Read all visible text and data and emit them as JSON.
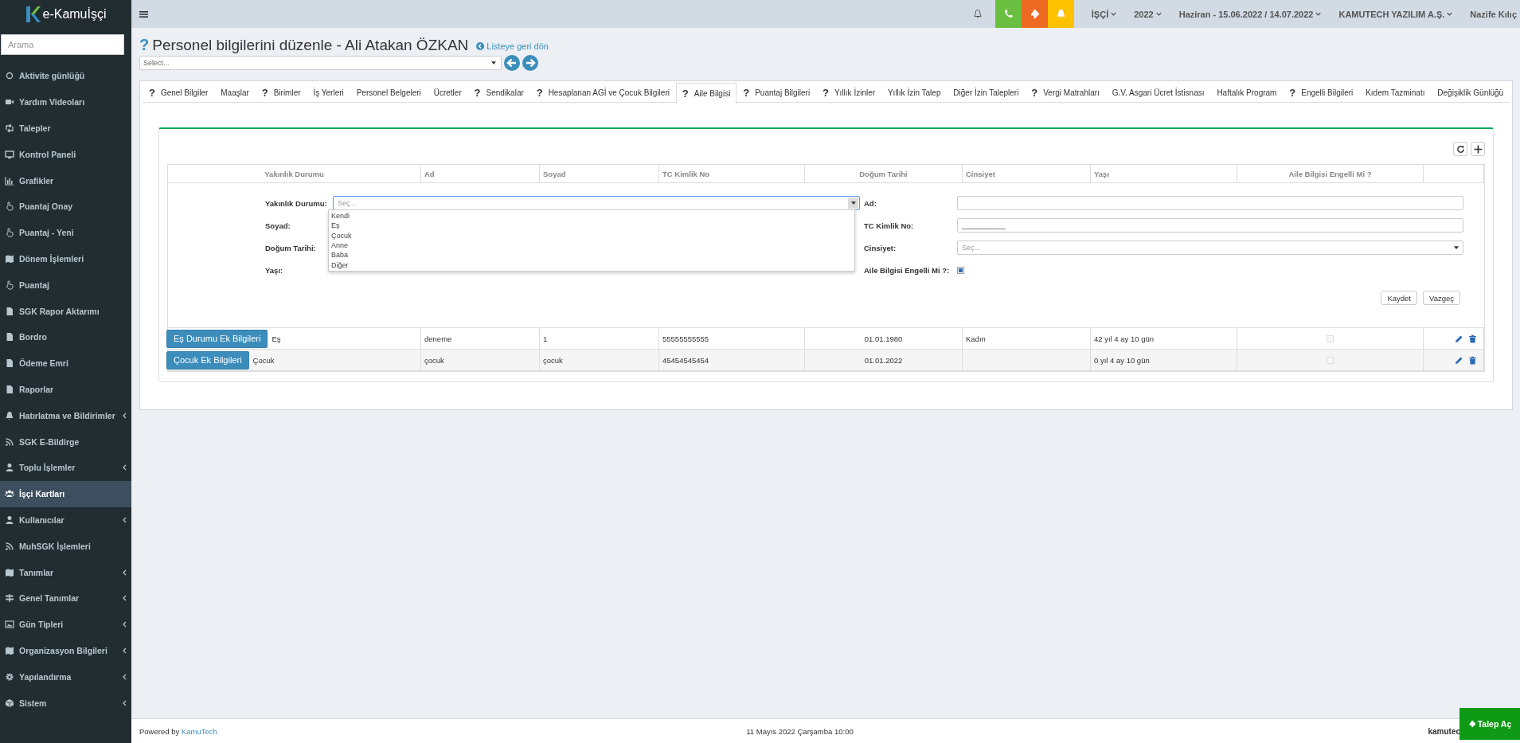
{
  "sidebar": {
    "logo": "e-Kamuİşçi",
    "search": {
      "placeholder": "Arama"
    },
    "items": [
      {
        "label": "Aktivite günlüğü",
        "expandable": false,
        "selected": false
      },
      {
        "label": "Yardım Videoları",
        "expandable": false,
        "selected": false
      },
      {
        "label": "Talepler",
        "expandable": false,
        "selected": false
      },
      {
        "label": "Kontrol Paneli",
        "expandable": false,
        "selected": false
      },
      {
        "label": "Grafikler",
        "expandable": false,
        "selected": false
      },
      {
        "label": "Puantaj Onay",
        "expandable": false,
        "selected": false
      },
      {
        "label": "Puantaj - Yeni",
        "expandable": false,
        "selected": false
      },
      {
        "label": "Dönem İşlemleri",
        "expandable": false,
        "selected": false
      },
      {
        "label": "Puantaj",
        "expandable": false,
        "selected": false
      },
      {
        "label": "SGK Rapor Aktarımı",
        "expandable": false,
        "selected": false
      },
      {
        "label": "Bordro",
        "expandable": false,
        "selected": false
      },
      {
        "label": "Ödeme Emri",
        "expandable": false,
        "selected": false
      },
      {
        "label": "Raporlar",
        "expandable": false,
        "selected": false
      },
      {
        "label": "Hatırlatma ve Bildirimler",
        "expandable": true,
        "selected": false
      },
      {
        "label": "SGK E-Bildirge",
        "expandable": false,
        "selected": false
      },
      {
        "label": "Toplu İşlemler",
        "expandable": true,
        "selected": false
      },
      {
        "label": "İşçi Kartları",
        "expandable": false,
        "selected": true
      },
      {
        "label": "Kullanıcılar",
        "expandable": true,
        "selected": false
      },
      {
        "label": "MuhSGK İşlemleri",
        "expandable": false,
        "selected": false
      },
      {
        "label": "Tanımlar",
        "expandable": true,
        "selected": false
      },
      {
        "label": "Genel Tanımlar",
        "expandable": true,
        "selected": false
      },
      {
        "label": "Gün Tipleri",
        "expandable": true,
        "selected": false
      },
      {
        "label": "Organizasyon Bilgileri",
        "expandable": true,
        "selected": false
      },
      {
        "label": "Yapılandırma",
        "expandable": true,
        "selected": false
      },
      {
        "label": "Sistem",
        "expandable": true,
        "selected": false
      }
    ]
  },
  "topbar": {
    "buttons": [
      {
        "color": "#6abf40"
      },
      {
        "color": "#ee6a23"
      },
      {
        "color": "#ffc200"
      }
    ],
    "menus": [
      "İŞÇİ",
      "2022",
      "Haziran - 15.06.2022 / 14.07.2022",
      "KAMUTECH YAZILIM A.Ş."
    ],
    "user": "Nazife Kılıç"
  },
  "page": {
    "title_mark": "?",
    "title": "Personel bilgilerini düzenle - Ali Atakan ÖZKAN",
    "back_link": "Listeye geri dön",
    "select": {
      "placeholder": "Select..."
    }
  },
  "tabs": [
    {
      "mark": "?",
      "label": "Genel Bilgiler",
      "selected": false
    },
    {
      "label": "Maaşlar",
      "selected": false
    },
    {
      "mark": "?",
      "label": "Birimler",
      "selected": false
    },
    {
      "label": "İş Yerleri",
      "selected": false
    },
    {
      "label": "Personel Belgeleri",
      "selected": false
    },
    {
      "label": "Ücretler",
      "selected": false
    },
    {
      "mark": "?",
      "label": "Sendikalar",
      "selected": false
    },
    {
      "mark": "?",
      "label": "Hesaplanan AGİ ve Çocuk Bilgileri",
      "selected": false
    },
    {
      "mark": "?",
      "label": "Aile Bilgisi",
      "selected": true
    },
    {
      "mark": "?",
      "label": "Puantaj Bilgileri",
      "selected": false
    },
    {
      "mark": "?",
      "label": "Yıllık İzinler",
      "selected": false
    },
    {
      "label": "Yıllık İzin Talep",
      "selected": false
    },
    {
      "label": "Diğer İzin Talepleri",
      "selected": false
    },
    {
      "mark": "?",
      "label": "Vergi Matrahları",
      "selected": false
    },
    {
      "label": "G.V. Asgari Ücret İstisnası",
      "selected": false
    },
    {
      "label": "Haftalık Program",
      "selected": false
    },
    {
      "mark": "?",
      "label": "Engelli Bilgileri",
      "selected": false
    },
    {
      "label": "Kıdem Tazminatı",
      "selected": false
    },
    {
      "label": "Değişiklik Günlüğü",
      "selected": false
    }
  ],
  "table": {
    "columns": [
      "Yakınlık Durumu",
      "Ad",
      "Soyad",
      "TC Kimlik No",
      "Doğum Tarihi",
      "Cinsiyet",
      "Yaşı",
      "Aile Bilgisi Engelli Mi ?"
    ],
    "form": {
      "left": [
        {
          "label": "Yakınlık Durumu:",
          "placeholder": "Seç...",
          "options": [
            "Kendi",
            "Eş",
            "Çocuk",
            "Anne",
            "Baba",
            "Diğer"
          ]
        },
        {
          "label": "Soyad:"
        },
        {
          "label": "Doğum Tarihi:"
        },
        {
          "label": "Yaşı:"
        }
      ],
      "right": [
        {
          "kind": "text",
          "label": "Ad:"
        },
        {
          "kind": "text",
          "label": "TC Kimlik No:",
          "value": "___________"
        },
        {
          "kind": "select",
          "label": "Cinsiyet:",
          "placeholder": "Seç..."
        },
        {
          "kind": "checkbox",
          "label": "Aile Bilgisi Engelli Mi ?:",
          "checked": true
        }
      ],
      "buttons": [
        "Kaydet",
        "Vazgeç"
      ]
    },
    "rows": [
      {
        "button": "Eş Durumu Ek Bilgileri",
        "relation": "Eş",
        "ad": "deneme",
        "soyad": "1",
        "tc": "55555555555",
        "dogum": "01.01.1980",
        "cinsiyet": "Kadın",
        "yas": "42 yıl 4 ay 10 gün",
        "engelli": false
      },
      {
        "button": "Çocuk Ek Bilgileri",
        "relation": "Çocuk",
        "ad": "çocuk",
        "soyad": "çocuk",
        "tc": "45454545454",
        "dogum": "01.01.2022",
        "yas": "0 yıl 4 ay 10 gün",
        "engelli": false
      }
    ]
  },
  "footer": {
    "powered": "Powered by",
    "link": "KamuTech",
    "date": "11 Mayıs 2022 Çarşamba 10:00",
    "right": "kamutec",
    "request_button": "Talep Aç"
  }
}
